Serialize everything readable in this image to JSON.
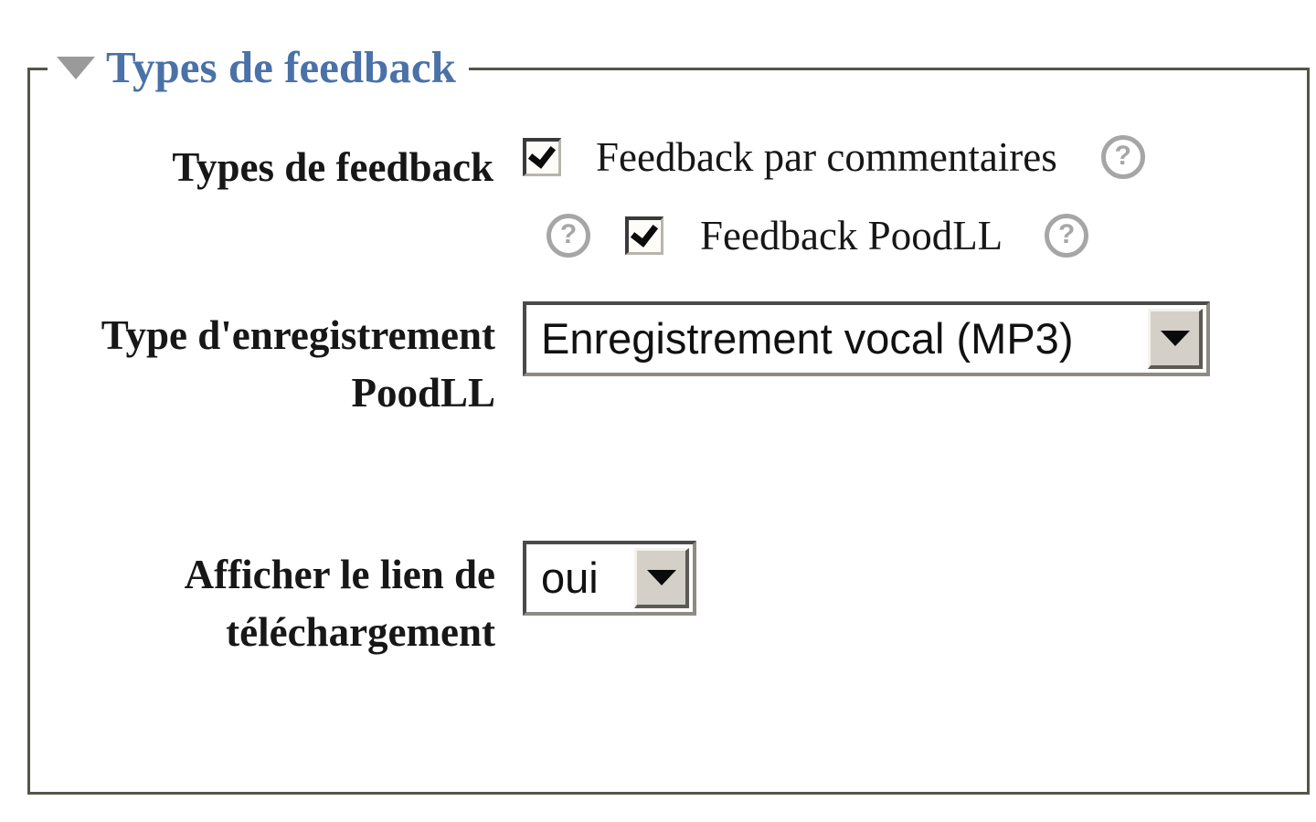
{
  "section": {
    "legend_title": "Types de feedback",
    "toggle_icon": "triangle-down-icon",
    "expanded": true
  },
  "rows": [
    {
      "id": "feedback-types",
      "label": "Types de feedback",
      "options": [
        {
          "id": "feedback-comments",
          "label": "Feedback par commentaires",
          "checked": true,
          "checkbox_glyph": "✓",
          "help_before": false,
          "help_after": true,
          "help_glyph": "?"
        },
        {
          "id": "feedback-poodll",
          "label": "Feedback PoodLL",
          "checked": true,
          "checkbox_glyph": "✓",
          "help_before": true,
          "help_after": true,
          "help_glyph": "?"
        }
      ]
    },
    {
      "id": "poodll-recording-type",
      "label": "Type d'enregistrement PoodLL",
      "control": "select",
      "value": "Enregistrement vocal (MP3)",
      "arrow_icon": "triangle-down-icon"
    },
    {
      "id": "show-download-link",
      "label": "Afficher le lien de téléchargement",
      "control": "select",
      "value": "oui",
      "arrow_icon": "triangle-down-icon"
    }
  ],
  "colors": {
    "legend_blue": "#4a72a8",
    "border_gray": "#55544a",
    "label_dark": "#171717",
    "help_gray": "#a6a6a6",
    "button_face": "#d4d0c8",
    "page_background": "#ffffff"
  }
}
